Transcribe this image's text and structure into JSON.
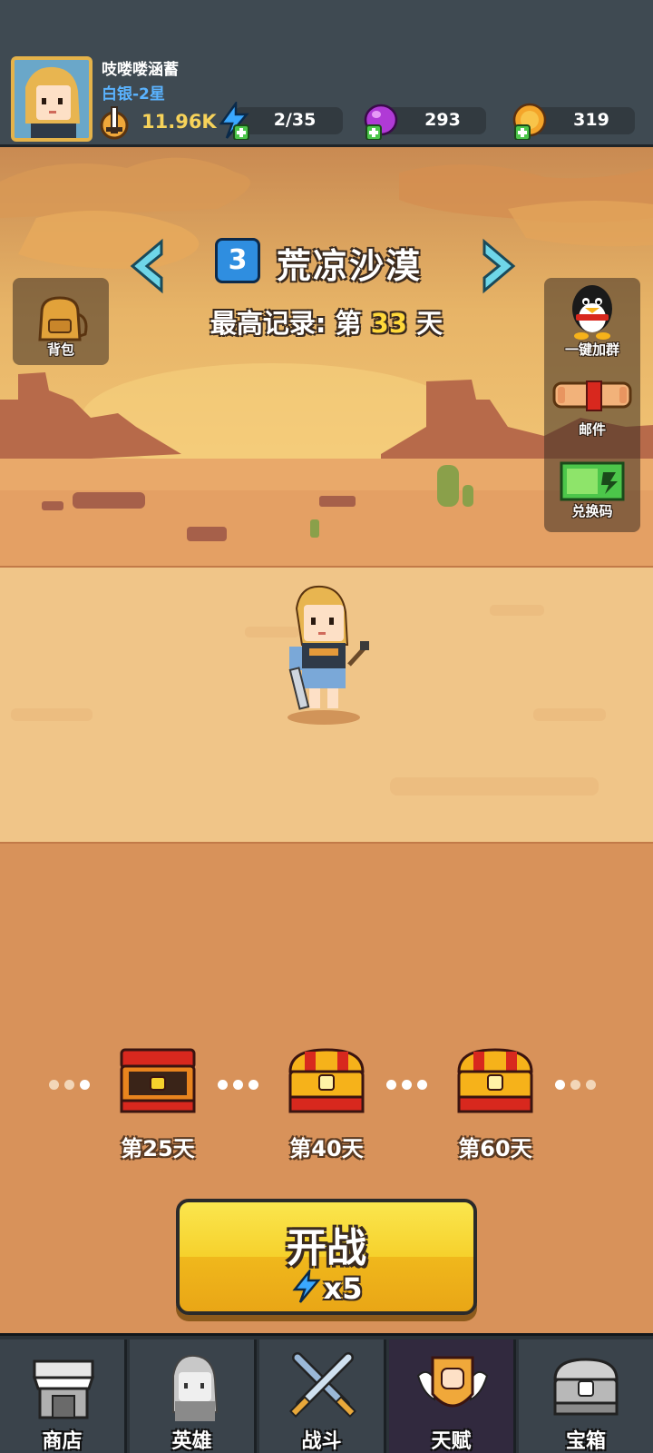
{
  "player": {
    "name": "吱喽喽涵蓄",
    "rank": "白银-2星",
    "power": "11.96K"
  },
  "resources": {
    "energy": "2/35",
    "gems": "293",
    "coins": "319"
  },
  "stage": {
    "number": "3",
    "name": "荒凉沙漠",
    "best_prefix": "最高记录: 第",
    "best_day": "33",
    "best_suffix": "天"
  },
  "side_buttons": {
    "backpack": "背包",
    "join_group": "一键加群",
    "mail": "邮件",
    "redeem": "兑换码"
  },
  "milestones": [
    {
      "label": "第25天",
      "state": "opened"
    },
    {
      "label": "第40天",
      "state": "closed"
    },
    {
      "label": "第60天",
      "state": "closed"
    }
  ],
  "start": {
    "label": "开战",
    "cost": "x5"
  },
  "nav": [
    {
      "label": "商店",
      "icon": "shop-icon"
    },
    {
      "label": "英雄",
      "icon": "hero-icon"
    },
    {
      "label": "战斗",
      "icon": "crossed-swords-icon"
    },
    {
      "label": "天赋",
      "icon": "talent-fist-icon"
    },
    {
      "label": "宝箱",
      "icon": "treasure-chest-icon"
    }
  ],
  "colors": {
    "topbar": "#3f4a52",
    "rank": "#5ab3ff",
    "power": "#f7d35a",
    "highlight": "#ffd83a",
    "start_button": "#f6d12c",
    "nav_bg": "#2b3238"
  }
}
